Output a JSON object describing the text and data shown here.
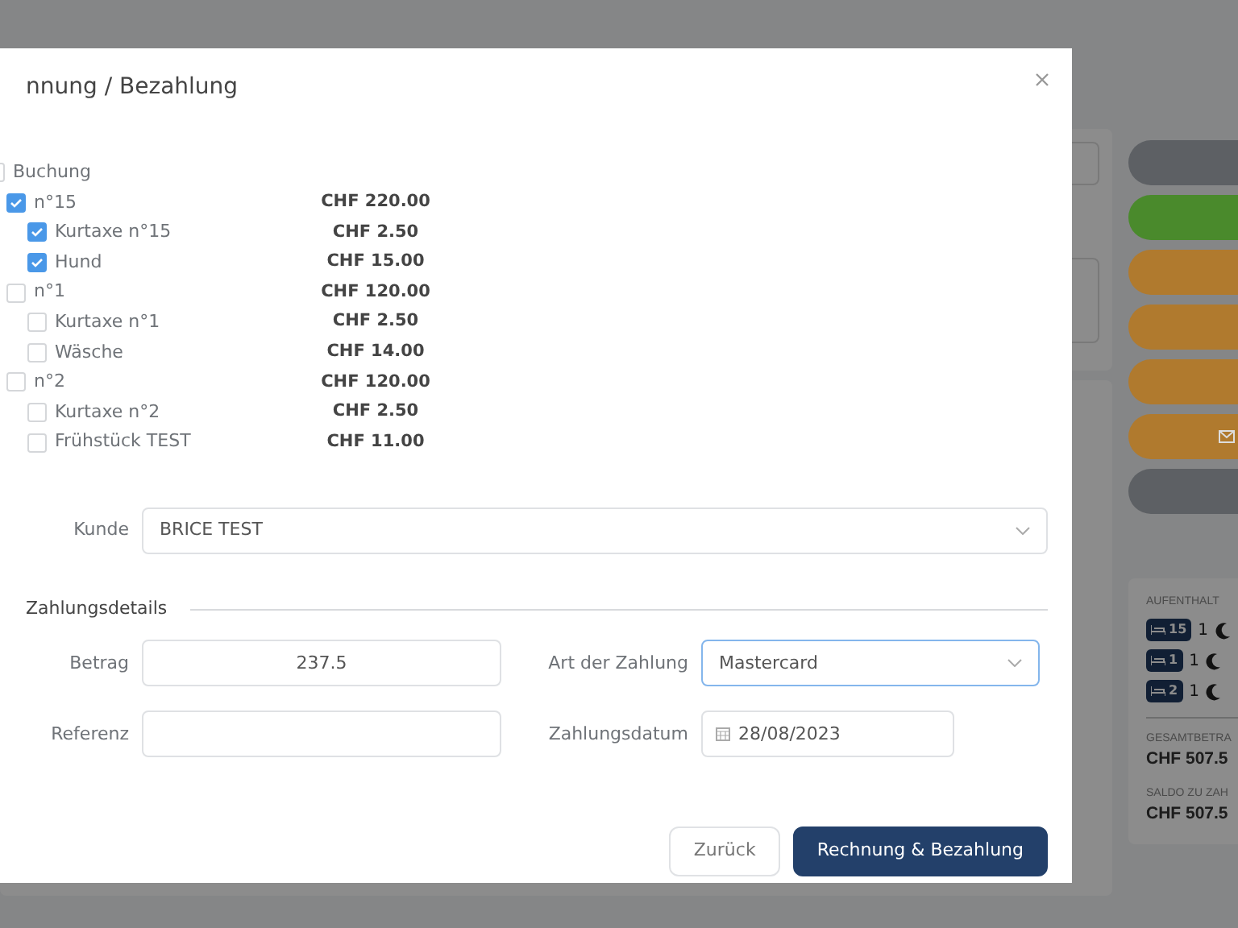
{
  "background": {
    "status_buttons": [
      {
        "color": "#5d6064",
        "kind": "plain"
      },
      {
        "color": "#4a8a2c",
        "kind": "plain"
      },
      {
        "color": "#b07a2e",
        "kind": "plain"
      },
      {
        "color": "#b07a2e",
        "kind": "plain"
      },
      {
        "color": "#b07a2e",
        "kind": "plain"
      },
      {
        "color": "#b07a2e",
        "kind": "mail"
      },
      {
        "color": "#5d6064",
        "kind": "plain"
      }
    ],
    "stay_summary": {
      "heading": "AUFENTHALT",
      "rooms": [
        {
          "room": "15",
          "nights": "1"
        },
        {
          "room": "1",
          "nights": "1"
        },
        {
          "room": "2",
          "nights": "1"
        }
      ],
      "total_label": "GESAMTBETRA",
      "total": "CHF 507.5",
      "balance_label": "SALDO ZU ZAH",
      "balance": "CHF 507.5"
    }
  },
  "dialog": {
    "title": "nnung / Bezahlung",
    "tree": {
      "label": "Buchung",
      "checked": false,
      "children": [
        {
          "label": "n°15",
          "amount": "CHF 220.00",
          "checked": true,
          "children": [
            {
              "label": "Kurtaxe n°15",
              "amount": "CHF 2.50",
              "checked": true
            },
            {
              "label": "Hund",
              "amount": "CHF 15.00",
              "checked": true
            }
          ]
        },
        {
          "label": "n°1",
          "amount": "CHF 120.00",
          "checked": false,
          "children": [
            {
              "label": "Kurtaxe n°1",
              "amount": "CHF 2.50",
              "checked": false
            },
            {
              "label": "Wäsche",
              "amount": "CHF 14.00",
              "checked": false
            }
          ]
        },
        {
          "label": "n°2",
          "amount": "CHF 120.00",
          "checked": false,
          "children": [
            {
              "label": "Kurtaxe n°2",
              "amount": "CHF 2.50",
              "checked": false
            },
            {
              "label": "Frühstück TEST",
              "amount": "CHF 11.00",
              "checked": false
            }
          ]
        }
      ]
    },
    "customer": {
      "label": "Kunde",
      "value": "BRICE TEST"
    },
    "section": "Zahlungsdetails",
    "fields": [
      {
        "kind": "text",
        "label": "Betrag",
        "value": "237.5",
        "focused": false
      },
      {
        "kind": "select",
        "label": "Art der Zahlung",
        "value": "Mastercard",
        "focused": true
      },
      {
        "kind": "text",
        "label": "Referenz",
        "focused": false
      },
      {
        "kind": "date",
        "label": "Zahlungsdatum",
        "value": "28/08/2023",
        "focused": false
      }
    ],
    "buttons": [
      {
        "label": "Zurück",
        "kind": "secondary"
      },
      {
        "label": "Rechnung & Bezahlung",
        "kind": "primary"
      }
    ]
  }
}
